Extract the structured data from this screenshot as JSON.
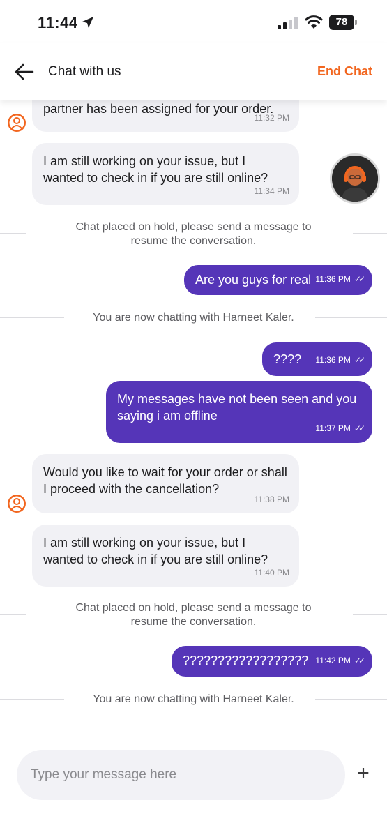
{
  "status_bar": {
    "time": "11:44",
    "battery": "78"
  },
  "header": {
    "title": "Chat with us",
    "end_chat_label": "End Chat"
  },
  "colors": {
    "accent": "#f2661f",
    "outgoing_bubble": "#5535b8",
    "incoming_bubble": "#f1f1f5"
  },
  "messages": [
    {
      "type": "in",
      "text": "partner has been assigned for your order.",
      "time": "11:32 PM"
    },
    {
      "type": "in",
      "text": "I am still working on your issue, but I wanted to check in if you are still online?",
      "time": "11:34 PM"
    },
    {
      "type": "system",
      "text": "Chat placed on hold, please send a message to resume the conversation."
    },
    {
      "type": "out",
      "text": "Are you guys for real",
      "time": "11:36 PM"
    },
    {
      "type": "system",
      "text": "You are now chatting with Harneet Kaler."
    },
    {
      "type": "out",
      "text": "????",
      "time": "11:36 PM"
    },
    {
      "type": "out",
      "text": "My messages have not been seen and you saying i am offline",
      "time": "11:37 PM"
    },
    {
      "type": "in",
      "text": "Would you like to wait for your order or shall I proceed with the cancellation?",
      "time": "11:38 PM"
    },
    {
      "type": "in",
      "text": "I am still working on your issue, but I wanted to check in if you are still online?",
      "time": "11:40 PM"
    },
    {
      "type": "system",
      "text": "Chat placed on hold, please send a message to resume the conversation."
    },
    {
      "type": "out",
      "text": "??????????????????",
      "time": "11:42 PM"
    },
    {
      "type": "system",
      "text": "You are now chatting with Harneet Kaler."
    }
  ],
  "composer": {
    "placeholder": "Type your message here",
    "add_label": "+"
  },
  "icons": {
    "back": "arrow-left-icon",
    "location": "location-arrow-icon",
    "add": "plus-icon",
    "agent_avatar": "agent-avatar-icon"
  }
}
